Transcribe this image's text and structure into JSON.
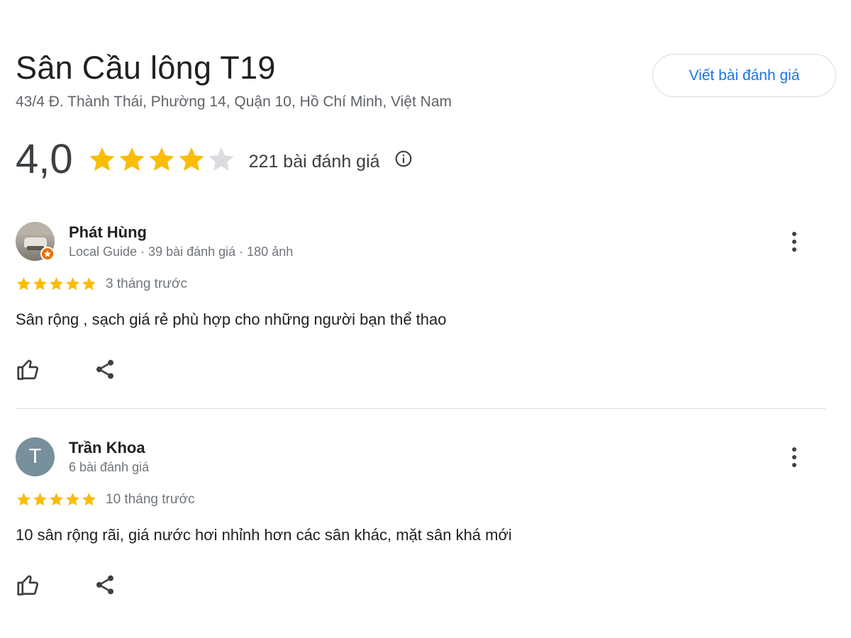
{
  "place": {
    "name": "Sân Cầu lông T19",
    "address": "43/4 Đ. Thành Thái, Phường 14, Quận 10, Hồ Chí Minh, Việt Nam"
  },
  "write_review_label": "Viết bài đánh giá",
  "rating": {
    "value": "4,0",
    "stars": 4,
    "max_stars": 5,
    "count_label": "221 bài đánh giá"
  },
  "colors": {
    "star_filled": "#fbbc04",
    "star_empty": "#dadce0",
    "accent": "#1a73e8",
    "badge": "#e8710a",
    "avatar_letter_bg": "#78909c"
  },
  "icons": {
    "info": "info-icon",
    "more": "more-vert-icon",
    "like": "thumb-up-icon",
    "share": "share-icon",
    "guide_badge": "local-guide-badge-icon"
  },
  "reviews": [
    {
      "name": "Phát Hùng",
      "meta": "Local Guide · 39 bài đánh giá · 180 ảnh",
      "stars": 5,
      "time": "3 tháng trước",
      "text": "Sân rộng , sạch giá rẻ phù hợp cho những người bạn thể thao"
    },
    {
      "name": "Trần Khoa",
      "avatar_letter": "T",
      "meta": "6 bài đánh giá",
      "stars": 5,
      "time": "10 tháng trước",
      "text": "10 sân rộng rãi, giá nước hơi nhỉnh hơn các sân khác, mặt sân khá mới"
    }
  ]
}
